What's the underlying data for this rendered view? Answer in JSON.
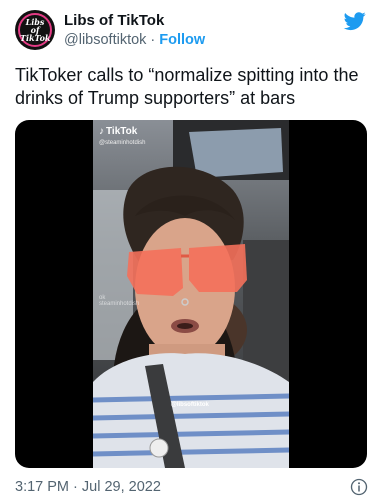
{
  "author": {
    "display_name": "Libs of TikTok",
    "handle": "@libsoftiktok",
    "separator": "·",
    "follow_label": "Follow",
    "avatar_text_line1": "Libs of",
    "avatar_text_line2": "TikTok"
  },
  "tweet": {
    "text": "TikToker calls to “normalize spitting into the drinks of Trump supporters” at bars",
    "timestamp": "3:17 PM · Jul 29, 2022"
  },
  "video": {
    "tiktok_logo": "TikTok",
    "tiktok_user": "@steaminhotdish",
    "watermark_logo": "ok",
    "watermark_user": "steaminhotdish",
    "credit": "@libsoftiktok"
  },
  "colors": {
    "accent": "#1d9bf0",
    "text": "#0f1419",
    "secondary": "#536471",
    "lens": "#f4705a"
  },
  "icons": [
    "twitter-bird-icon",
    "tiktok-note-icon",
    "info-icon"
  ]
}
